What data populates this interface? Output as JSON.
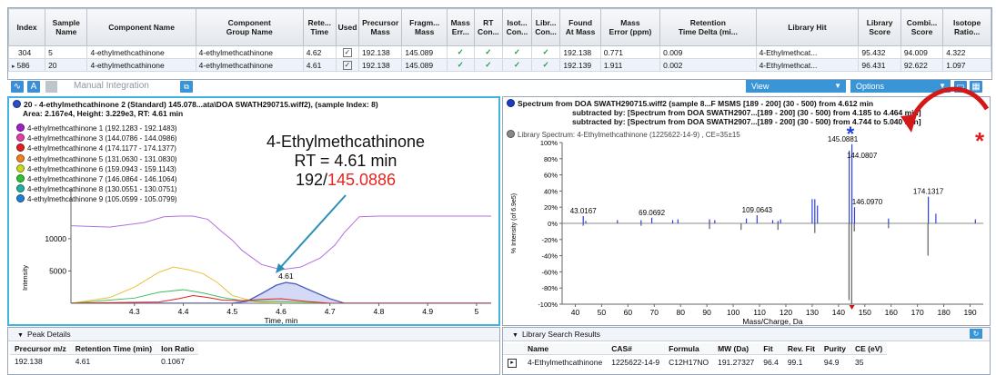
{
  "results_table": {
    "headers": [
      "Index",
      "Sample Name",
      "Component Name",
      "Component Group Name",
      "Retention Time",
      "Used",
      "Precursor Mass",
      "Fragment Mass",
      "Mass Err...",
      "RT Con...",
      "Isot... Con...",
      "Libr... Con...",
      "Found At Mass",
      "Mass Error (ppm)",
      "Retention Time Delta (mi...",
      "Library Hit",
      "Library Score",
      "Combi... Score",
      "Isotope Ratio..."
    ],
    "header_display": [
      "Index",
      "Sample\nName",
      "Component Name",
      "Component\nGroup Name",
      "Rete...\nTime",
      "Used",
      "Precursor\nMass",
      "Fragm...\nMass",
      "Mass\nErr...",
      "RT\nCon...",
      "Isot...\nCon...",
      "Libr...\nCon...",
      "Found\nAt Mass",
      "Mass\nError (ppm)",
      "Retention\nTime Delta (mi...",
      "Library Hit",
      "Library\nScore",
      "Combi...\nScore",
      "Isotope\nRatio..."
    ],
    "rows": [
      {
        "index": "304",
        "sample": "5",
        "component": "4-ethylmethcathinone",
        "group": "4-ethylmethcathinone",
        "rt": "4.62",
        "used": "✓",
        "precursor": "192.138",
        "fragment": "145.089",
        "mass_err": "✓",
        "rt_con": "✓",
        "isot_con": "✓",
        "libr_con": "✓",
        "found_mass": "192.138",
        "ppm": "0.771",
        "rt_delta": "0.009",
        "library_hit": "4-Ethylmethcat...",
        "library_score": "95.432",
        "combined_score": "94.009",
        "isotope_ratio": "4.322"
      },
      {
        "index": "586",
        "sample": "20",
        "component": "4-ethylmethcathinone",
        "group": "4-ethylmethcathinone",
        "rt": "4.61",
        "used": "✓",
        "precursor": "192.138",
        "fragment": "145.089",
        "mass_err": "✓",
        "rt_con": "✓",
        "isot_con": "✓",
        "libr_con": "✓",
        "found_mass": "192.139",
        "ppm": "1.911",
        "rt_delta": "0.002",
        "library_hit": "4-Ethylmethcat...",
        "library_score": "96.431",
        "combined_score": "92.622",
        "isotope_ratio": "1.097"
      }
    ]
  },
  "toolbar": {
    "manual_integration": "Manual Integration",
    "view_label": "View",
    "options_label": "Options"
  },
  "xic_panel": {
    "title": "20 - 4-ethylmethcathinone 2 (Standard) 145.078...ata\\DOA SWATH290715.wiff2), (sample Index: 8)",
    "subtitle": "Area: 2.167e4, Height: 3.229e3, RT: 4.61 min",
    "legend": [
      {
        "label": "4-ethylmethcathinone 1 (192.1283 - 192.1483)",
        "color": "#a020c8"
      },
      {
        "label": "4-ethylmethcathinone 3 (144.0786 - 144.0986)",
        "color": "#e040a0"
      },
      {
        "label": "4-ethylmethcathinone 4 (174.1177 - 174.1377)",
        "color": "#e02020"
      },
      {
        "label": "4-ethylmethcathinone 5 (131.0630 - 131.0830)",
        "color": "#f08020"
      },
      {
        "label": "4-ethylmethcathinone 6 (159.0943 - 159.1143)",
        "color": "#c8d820"
      },
      {
        "label": "4-ethylmethcathinone 7 (146.0864 - 146.1064)",
        "color": "#30c030"
      },
      {
        "label": "4-ethylmethcathinone 8 (130.0551 - 130.0751)",
        "color": "#20b0a0"
      },
      {
        "label": "4-ethylmethcathinone 9 (105.0599 - 105.0799)",
        "color": "#2080d0"
      }
    ],
    "annotation": {
      "line1": "4-Ethylmethcathinone",
      "line2": "RT = 4.61 min",
      "line3_black": "192/",
      "line3_red": "145.0886"
    },
    "peak_label": "4.61",
    "ylabel": "Intensity",
    "xlabel": "Time, min"
  },
  "spectrum_panel": {
    "title_line1": "Spectrum from DOA SWATH290715.wiff2 (sample 8...F MSMS [189 - 200] (30 - 500) from 4.612 min",
    "title_line2": "subtracted by: [Spectrum from DOA SWATH2907...[189 - 200] (30 - 500) from 4.185 to 4.464 min]",
    "title_line3": "subtracted by: [Spectrum from DOA SWATH2907...[189 - 200] (30 - 500) from 4.744 to 5.040 min]",
    "library_line": "Library Spectrum: 4-Ethylmethcathinone (1225622-14-9) , CE=35±15",
    "ylabel": "% Intensity (of 6.9e5)",
    "xlabel": "Mass/Charge, Da",
    "star_blue": "*",
    "star_red": "*"
  },
  "peak_details": {
    "header": "Peak Details",
    "columns": [
      "Precursor m/z",
      "Retention Time (min)",
      "Ion Ratio"
    ],
    "row": [
      "192.138",
      "4.61",
      "0.1067"
    ]
  },
  "library_results": {
    "header": "Library Search Results",
    "columns": [
      "",
      "Name",
      "CAS#",
      "Formula",
      "MW (Da)",
      "Fit",
      "Rev. Fit",
      "Purity",
      "CE (eV)"
    ],
    "row": [
      "",
      "4-Ethylmethcathinone",
      "1225622-14-9",
      "C12H17NO",
      "191.27327",
      "96.4",
      "99.1",
      "94.9",
      "35"
    ]
  },
  "chart_data": [
    {
      "type": "line",
      "title": "20 - 4-ethylmethcathinone 2 (Standard) 145.078...ata\\DOA SWATH290715.wiff2), (sample Index: 8)",
      "xlabel": "Time, min",
      "ylabel": "Intensity",
      "xlim": [
        4.17,
        5.03
      ],
      "ylim": [
        0,
        13500
      ],
      "xticks": [
        4.3,
        4.4,
        4.5,
        4.6,
        4.7,
        4.8,
        4.9,
        5.0
      ],
      "yticks": [
        5000,
        10000
      ],
      "series": [
        {
          "name": "4-ethylmethcathinone 1 (192.1283 - 192.1483)",
          "color": "#b070e0",
          "x": [
            4.17,
            4.25,
            4.32,
            4.36,
            4.39,
            4.42,
            4.45,
            4.48,
            4.5,
            4.52,
            4.56,
            4.6,
            4.64,
            4.68,
            4.71,
            4.73,
            4.76,
            4.8,
            4.85,
            4.9,
            4.95,
            5.0,
            5.03
          ],
          "y": [
            12000,
            11800,
            12500,
            13400,
            14500,
            14500,
            13000,
            11000,
            9800,
            8200,
            6000,
            5200,
            5600,
            7000,
            9000,
            11000,
            13400,
            14500,
            14500,
            14500,
            14500,
            14500,
            14500
          ]
        },
        {
          "name": "4-ethylmethcathinone 2 (Standard)",
          "color": "#5060c0",
          "x": [
            4.17,
            4.4,
            4.5,
            4.53,
            4.56,
            4.59,
            4.61,
            4.63,
            4.66,
            4.7,
            4.73,
            4.8,
            5.03
          ],
          "y": [
            0,
            0,
            0,
            300,
            1500,
            2800,
            3229,
            3000,
            2000,
            700,
            0,
            0,
            0
          ]
        },
        {
          "name": "4-ethylmethcathinone 5 (131.0630 - 131.0830)",
          "color": "#e8c040",
          "x": [
            4.17,
            4.25,
            4.3,
            4.35,
            4.38,
            4.41,
            4.44,
            4.47,
            4.5,
            4.55,
            4.6,
            5.03
          ],
          "y": [
            0,
            900,
            2500,
            4800,
            5600,
            5200,
            4600,
            3200,
            1200,
            200,
            0,
            0
          ]
        },
        {
          "name": "4-ethylmethcathinone 7 (146.0864 - 146.1064)",
          "color": "#40c060",
          "x": [
            4.17,
            4.3,
            4.35,
            4.4,
            4.44,
            4.48,
            4.52,
            4.57,
            4.62,
            4.7,
            5.03
          ],
          "y": [
            0,
            800,
            1700,
            2100,
            1600,
            900,
            400,
            300,
            200,
            0,
            0
          ]
        },
        {
          "name": "4-ethylmethcathinone 4 (174.1177 - 174.1377)",
          "color": "#e02020",
          "x": [
            4.17,
            4.35,
            4.39,
            4.42,
            4.45,
            4.48,
            4.52,
            4.56,
            4.6,
            4.65,
            4.7,
            5.03
          ],
          "y": [
            0,
            200,
            700,
            1200,
            900,
            500,
            400,
            600,
            700,
            300,
            0,
            0
          ]
        }
      ],
      "peak_label": "4.61"
    },
    {
      "type": "bar",
      "title": "Spectrum from DOA SWATH290715.wiff2 (sample 8...F MSMS [189 - 200] (30 - 500) from 4.612 min",
      "xlabel": "Mass/Charge, Da",
      "ylabel": "% Intensity (of 6.9e5)",
      "xlim": [
        35,
        195
      ],
      "ylim": [
        -100,
        100
      ],
      "xticks": [
        40,
        50,
        60,
        70,
        80,
        90,
        100,
        110,
        120,
        130,
        140,
        150,
        160,
        170,
        180,
        190
      ],
      "yticks": [
        -100,
        -80,
        -60,
        -40,
        -20,
        0,
        20,
        40,
        60,
        80,
        100
      ],
      "series": [
        {
          "name": "Sample spectrum",
          "color": "#3040e0",
          "x": [
            43.0167,
            44,
            56,
            65,
            69.0692,
            77,
            79,
            91,
            93,
            105,
            109.0643,
            115,
            117,
            118,
            130,
            131,
            132,
            144.0807,
            145.0881,
            146.097,
            159,
            174.1317,
            177,
            192
          ],
          "y": [
            9,
            3,
            4,
            4,
            7,
            4,
            5,
            5,
            4,
            6,
            10,
            4,
            3,
            5,
            30,
            30,
            22,
            90,
            98,
            20,
            6,
            33,
            12,
            5
          ]
        },
        {
          "name": "Library spectrum: 4-Ethylmethcathinone",
          "color": "#606060",
          "x": [
            43,
            65,
            91,
            103,
            117,
            131,
            144,
            145,
            146,
            159,
            174
          ],
          "y": [
            -3,
            -3,
            -7,
            -8,
            -8,
            -12,
            -95,
            -100,
            -10,
            -6,
            -40
          ]
        }
      ],
      "labels": [
        {
          "x": 43.0167,
          "text": "43.0167"
        },
        {
          "x": 69.0692,
          "text": "69.0692"
        },
        {
          "x": 109.0643,
          "text": "109.0643"
        },
        {
          "x": 144.0807,
          "text": "144.0807"
        },
        {
          "x": 145.0881,
          "text": "145.0881"
        },
        {
          "x": 146.097,
          "text": "146.0970"
        },
        {
          "x": 174.1317,
          "text": "174.1317"
        }
      ]
    }
  ]
}
